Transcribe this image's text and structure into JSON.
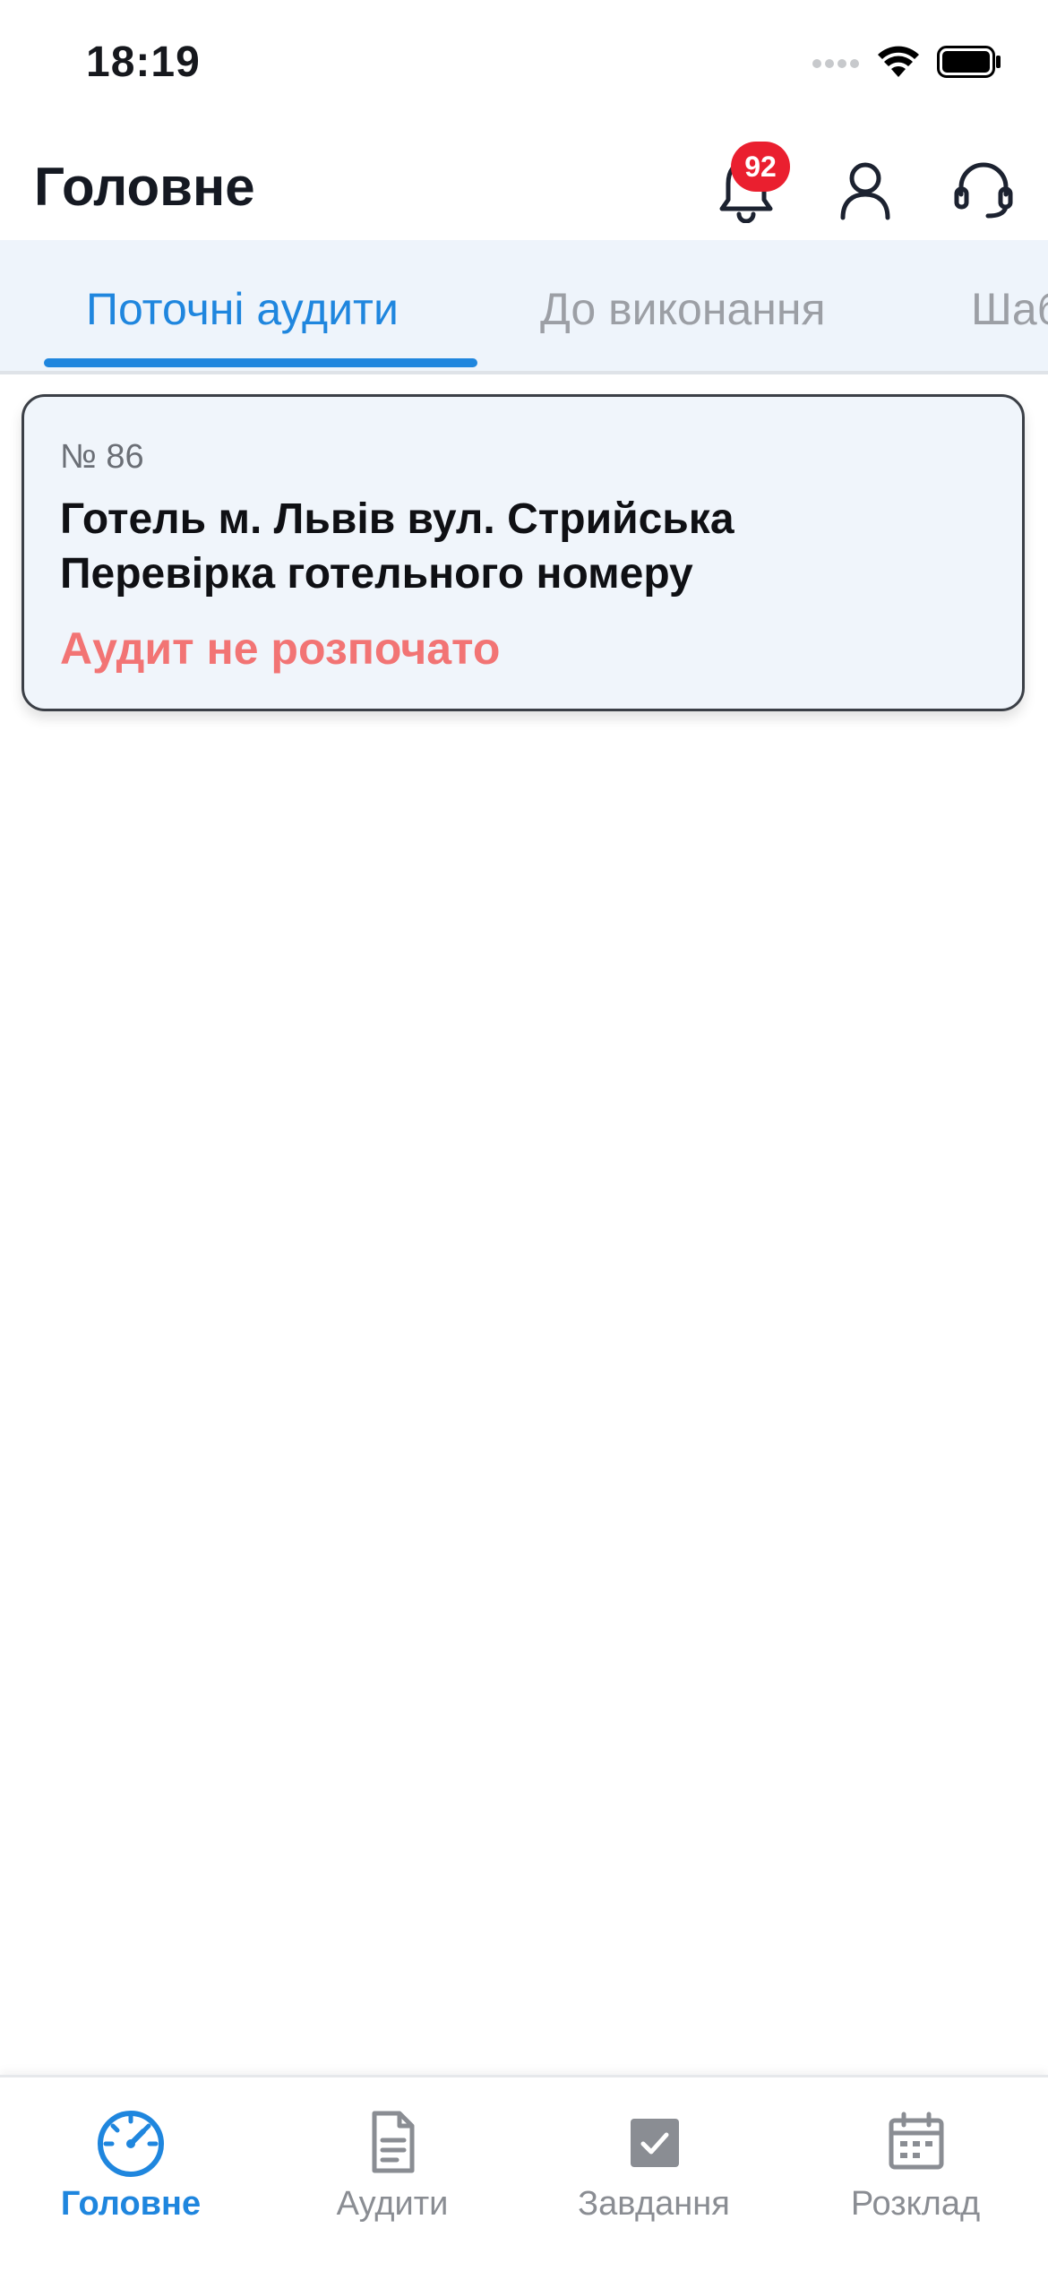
{
  "status_bar": {
    "time": "18:19"
  },
  "header": {
    "title": "Головне",
    "notifications_count": "92"
  },
  "tabs": [
    {
      "label": "Поточні аудити",
      "active": true
    },
    {
      "label": "До виконання",
      "active": false
    },
    {
      "label": "Шаб",
      "active": false
    }
  ],
  "audits": [
    {
      "number": "№ 86",
      "title_line1": "Готель м. Львів вул. Стрийська",
      "title_line2": "Перевірка готельного номеру",
      "status": "Аудит не розпочато"
    }
  ],
  "bottom_nav": [
    {
      "label": "Головне",
      "icon": "speedometer-icon",
      "active": true
    },
    {
      "label": "Аудити",
      "icon": "document-icon",
      "active": false
    },
    {
      "label": "Завдання",
      "icon": "checkbox-icon",
      "active": false
    },
    {
      "label": "Розклад",
      "icon": "calendar-icon",
      "active": false
    }
  ],
  "colors": {
    "accent": "#1f86de",
    "badge": "#ea1f2f",
    "status_not_started": "#f27474",
    "tabs_background": "#eef4fb",
    "card_background": "#f0f5fb"
  }
}
